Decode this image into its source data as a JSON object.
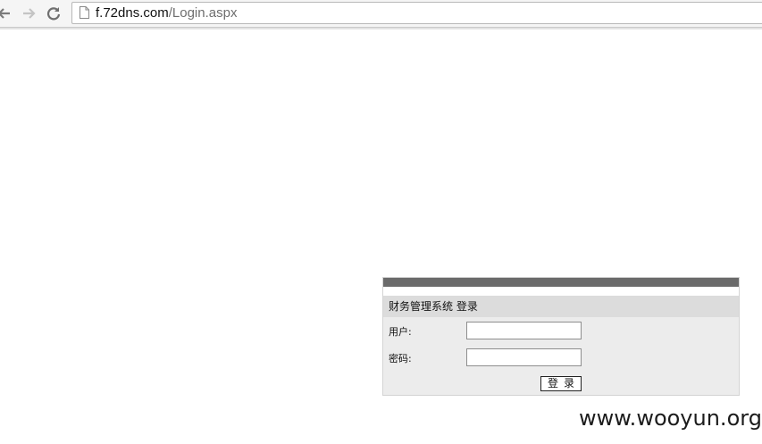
{
  "browser": {
    "url_host": "f.72dns.com",
    "url_path": "/Login.aspx",
    "icons": {
      "back": "arrow-left-icon",
      "forward": "arrow-right-icon",
      "reload": "reload-icon",
      "page": "page-icon"
    }
  },
  "login": {
    "title": "财务管理系统 登录",
    "username_label": "用户:",
    "username_value": "",
    "password_label": "密码:",
    "password_value": "",
    "submit_label": "登录"
  },
  "colors": {
    "panel_topbar": "#6a6a6a",
    "panel_header": "#dcdcdc",
    "panel_body": "#ececec"
  },
  "watermark": {
    "text": "www.wooyun.org"
  }
}
